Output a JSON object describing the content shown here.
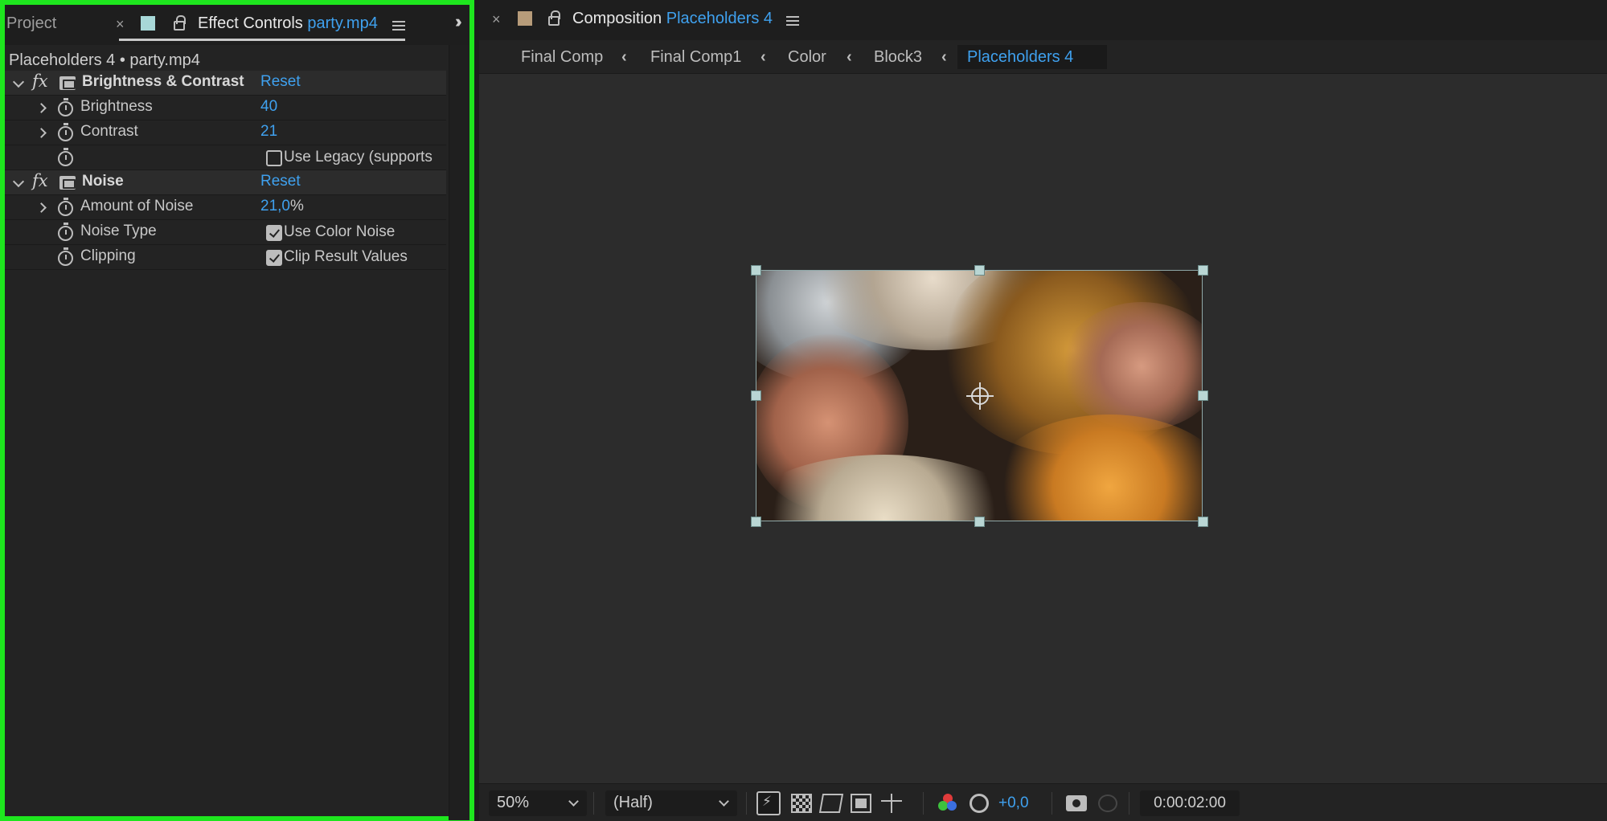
{
  "left_panel": {
    "tabs": {
      "project": "Project",
      "project_close": "×",
      "effect_controls_label": "Effect Controls",
      "effect_controls_file": "party.mp4"
    },
    "header": "Placeholders 4 • party.mp4",
    "effects": [
      {
        "name": "Brightness & Contrast",
        "reset": "Reset",
        "params": [
          {
            "label": "Brightness",
            "value": "40"
          },
          {
            "label": "Contrast",
            "value": "21"
          },
          {
            "label": "",
            "checkbox_label": "Use Legacy (supports",
            "checked": false
          }
        ]
      },
      {
        "name": "Noise",
        "reset": "Reset",
        "params": [
          {
            "label": "Amount of Noise",
            "value": "21,0",
            "unit": "%"
          },
          {
            "label": "Noise Type",
            "checkbox_label": "Use Color Noise",
            "checked": true
          },
          {
            "label": "Clipping",
            "checkbox_label": "Clip Result Values",
            "checked": true
          }
        ]
      }
    ],
    "highlight_color": "#1ee61e"
  },
  "composition": {
    "close": "×",
    "label": "Composition",
    "name": "Placeholders 4",
    "breadcrumbs": [
      "Final Comp",
      "Final Comp1",
      "Color",
      "Block3",
      "Placeholders 4"
    ],
    "separator": "‹"
  },
  "viewer_toolbar": {
    "zoom": "50%",
    "resolution": "(Half)",
    "exposure": "+0,0",
    "timecode": "0:00:02:00"
  },
  "colors": {
    "accent_blue": "#3fa1ef",
    "panel_bg": "#232323",
    "viewer_bg": "#2c2c2c"
  }
}
